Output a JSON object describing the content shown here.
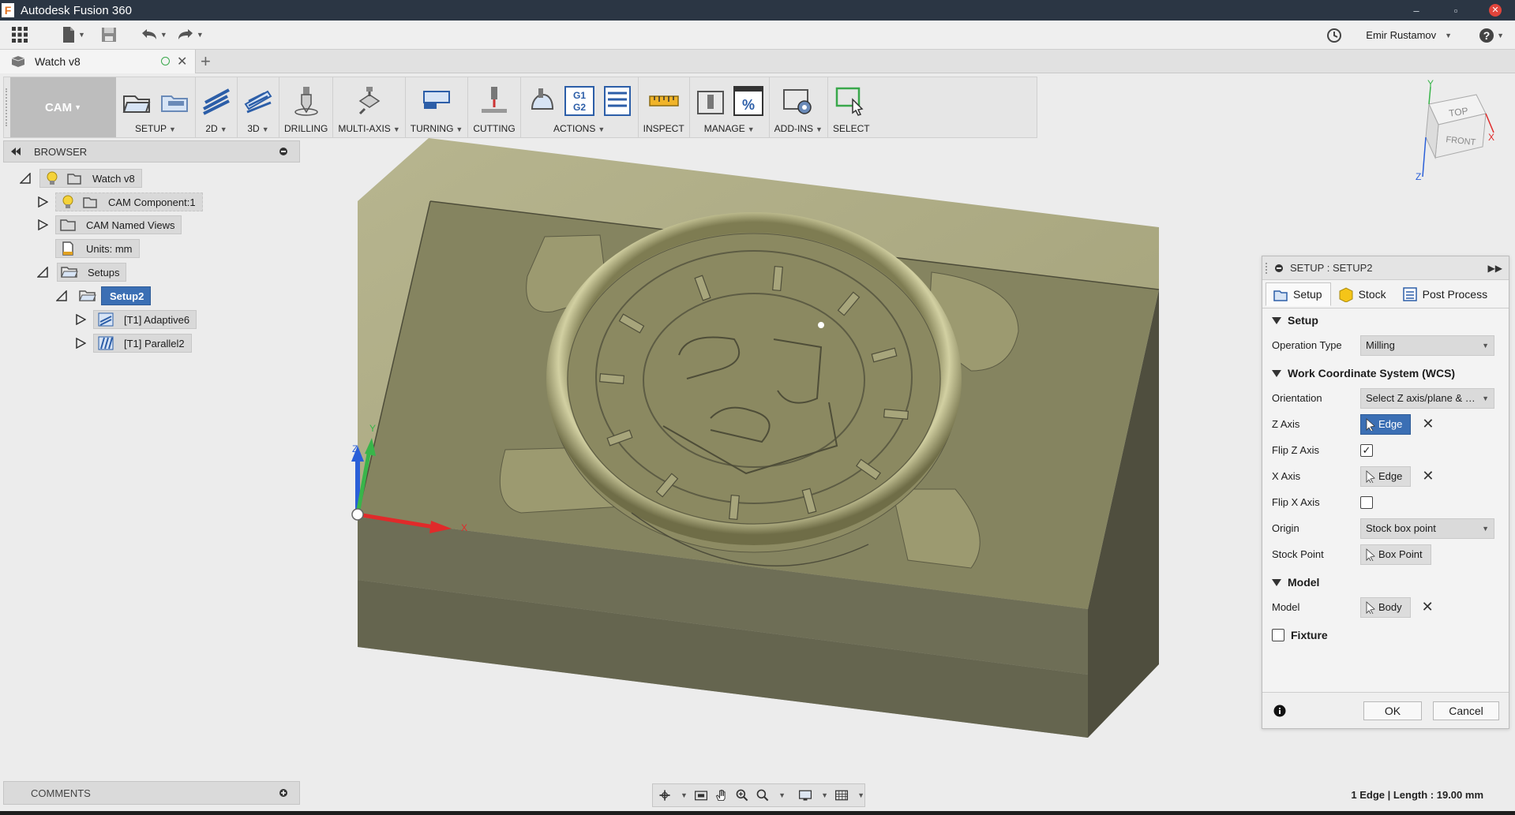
{
  "window": {
    "title": "Autodesk Fusion 360"
  },
  "user": {
    "name": "Emir Rustamov"
  },
  "document": {
    "tab_title": "Watch v8"
  },
  "ribbon": {
    "workspace": "CAM",
    "groups": [
      {
        "label": "SETUP",
        "dropdown": true
      },
      {
        "label": "2D",
        "dropdown": true
      },
      {
        "label": "3D",
        "dropdown": true
      },
      {
        "label": "DRILLING",
        "dropdown": false
      },
      {
        "label": "MULTI-AXIS",
        "dropdown": true
      },
      {
        "label": "TURNING",
        "dropdown": true
      },
      {
        "label": "CUTTING",
        "dropdown": false
      },
      {
        "label": "ACTIONS",
        "dropdown": true
      },
      {
        "label": "INSPECT",
        "dropdown": false
      },
      {
        "label": "MANAGE",
        "dropdown": true
      },
      {
        "label": "ADD-INS",
        "dropdown": true
      },
      {
        "label": "SELECT",
        "dropdown": false
      }
    ],
    "actions_icon_text": [
      "G1",
      "G2"
    ]
  },
  "browser": {
    "title": "BROWSER",
    "nodes": [
      {
        "label": "Watch v8"
      },
      {
        "label": "CAM Component:1"
      },
      {
        "label": "CAM Named Views"
      },
      {
        "label": "Units: mm"
      },
      {
        "label": "Setups"
      },
      {
        "label": "Setup2"
      },
      {
        "label": "[T1] Adaptive6"
      },
      {
        "label": "[T1] Parallel2"
      }
    ]
  },
  "viewcube": {
    "top": "TOP",
    "front": "FRONT",
    "axes": [
      "Y",
      "X",
      "Z"
    ]
  },
  "triad": {
    "z": "Z",
    "y": "Y",
    "x": "X"
  },
  "setup_panel": {
    "title": "SETUP : SETUP2",
    "tabs": [
      "Setup",
      "Stock",
      "Post Process"
    ],
    "section_setup": "Setup",
    "operation_type_label": "Operation Type",
    "operation_type_value": "Milling",
    "section_wcs": "Work Coordinate System (WCS)",
    "orientation_label": "Orientation",
    "orientation_value": "Select Z axis/plane & X axis",
    "z_axis_label": "Z Axis",
    "z_axis_value": "Edge",
    "flip_z_label": "Flip Z Axis",
    "flip_z_checked": true,
    "x_axis_label": "X Axis",
    "x_axis_value": "Edge",
    "flip_x_label": "Flip X Axis",
    "flip_x_checked": false,
    "origin_label": "Origin",
    "origin_value": "Stock box point",
    "stock_point_label": "Stock Point",
    "stock_point_value": "Box Point",
    "section_model": "Model",
    "model_label": "Model",
    "model_value": "Body",
    "fixture_label": "Fixture",
    "fixture_checked": false,
    "ok_label": "OK",
    "cancel_label": "Cancel"
  },
  "comments": {
    "title": "COMMENTS"
  },
  "status_bar": {
    "text": "1 Edge | Length : 19.00 mm"
  },
  "colors": {
    "selection_blue": "#3b6fb4",
    "title_bar": "#2b3644",
    "stock_olive": "#a09f76"
  }
}
